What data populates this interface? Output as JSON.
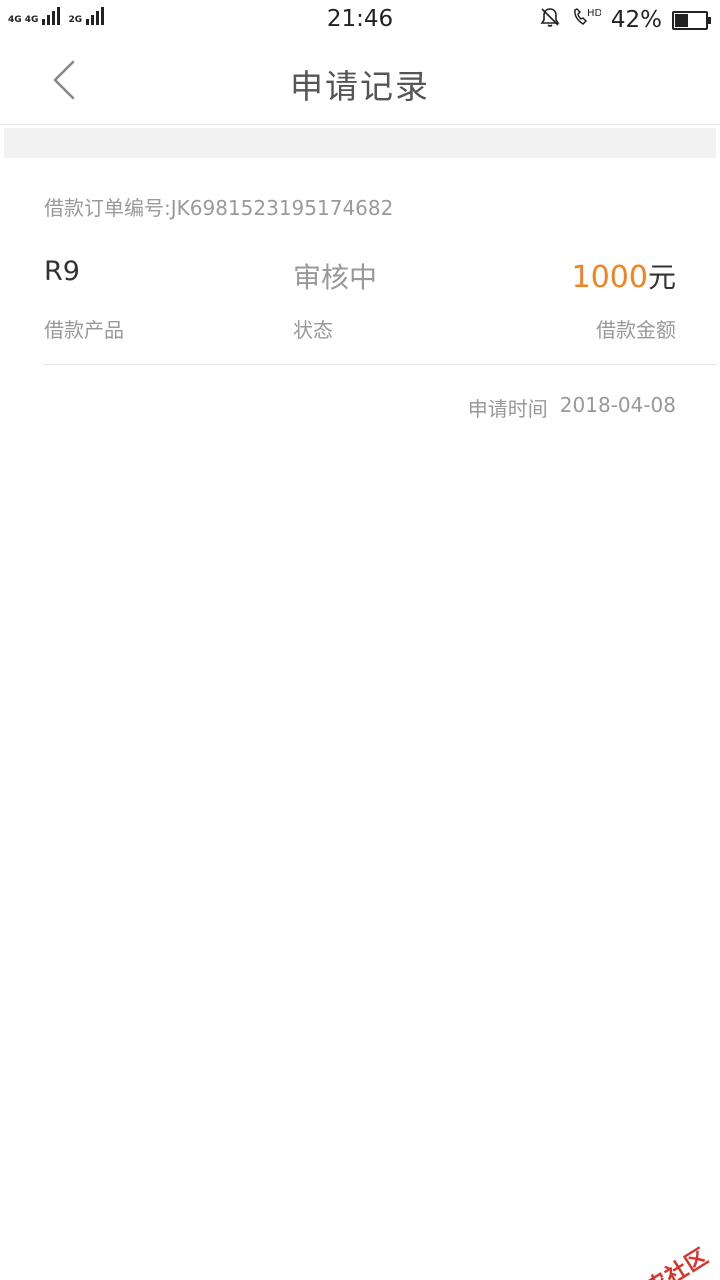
{
  "status_bar": {
    "net1": "4G 4G",
    "net2": "2G",
    "time": "21:46",
    "battery_text": "42%",
    "battery_level": 0.42
  },
  "header": {
    "title": "申请记录",
    "back_icon": "chevron-left-icon"
  },
  "record": {
    "order_label": "借款订单编号:",
    "order_number": "JK6981523195174682",
    "product_value": "R9",
    "product_label": "借款产品",
    "status_value": "审核中",
    "status_label": "状态",
    "amount_value": "1000",
    "amount_unit": "元",
    "amount_label": "借款金额",
    "apply_time_label": "申请时间",
    "apply_time_value": "2018-04-08"
  },
  "colors": {
    "accent_amount": "#f5821f",
    "watermark": "#d9332b"
  },
  "watermark": {
    "text": "卡农社区"
  }
}
